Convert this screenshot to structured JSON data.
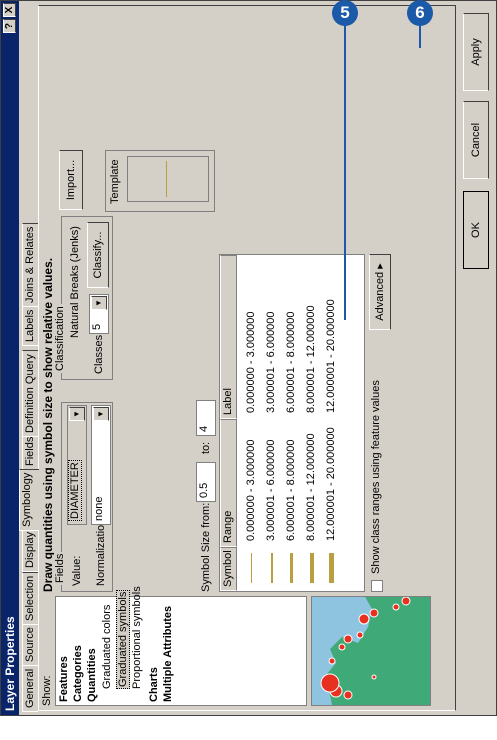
{
  "window": {
    "title": "Layer Properties",
    "help_btn": "?",
    "close_btn": "X"
  },
  "tabs": [
    "General",
    "Source",
    "Selection",
    "Display",
    "Symbology",
    "Fields",
    "Definition Query",
    "Labels",
    "Joins & Relates"
  ],
  "active_tab": "Symbology",
  "show": {
    "label": "Show:",
    "items": [
      "Features",
      "Categories",
      "Quantities",
      "Graduated colors",
      "Graduated symbols",
      "Proportional symbols",
      "Charts",
      "Multiple Attributes"
    ],
    "selected": "Graduated symbols",
    "import_button": "Import..."
  },
  "heading": "Draw quantities using symbol size to show relative values.",
  "fields": {
    "group_label": "Fields",
    "value_label": "Value:",
    "value": "DIAMETER",
    "normalization_label": "Normalization:",
    "normalization": "none"
  },
  "classification": {
    "group_label": "Classification",
    "method": "Natural Breaks (Jenks)",
    "classes_label": "Classes:",
    "classes": "5",
    "classify_button": "Classify..."
  },
  "symbol_size": {
    "from_label": "Symbol Size from:",
    "from": "0.5",
    "to_label": "to:",
    "to": "4"
  },
  "template": {
    "label": "Template"
  },
  "table": {
    "columns": [
      "Symbol",
      "Range",
      "Label"
    ],
    "rows": [
      {
        "range": "0.000000 - 3.000000",
        "label": "0.000000 - 3.000000",
        "weight": 1
      },
      {
        "range": "3.000001 - 6.000000",
        "label": "3.000001 - 6.000000",
        "weight": 2
      },
      {
        "range": "6.000001 - 8.000000",
        "label": "6.000001 - 8.000000",
        "weight": 3
      },
      {
        "range": "8.000001 - 12.000000",
        "label": "8.000001 - 12.000000",
        "weight": 4
      },
      {
        "range": "12.000001 - 20.000000",
        "label": "12.000001 - 20.000000",
        "weight": 5
      }
    ]
  },
  "advanced_button": "Advanced",
  "show_class_ranges": "Show class ranges using feature values",
  "buttons": {
    "ok": "OK",
    "cancel": "Cancel",
    "apply": "Apply"
  },
  "callouts": [
    "5",
    "6"
  ],
  "colors": {
    "title_bar": "#0a246a",
    "dialog": "#d4d0c8",
    "callout": "#1a5aa8",
    "symbol": "#b8a040",
    "map_dot": "#e83020"
  }
}
